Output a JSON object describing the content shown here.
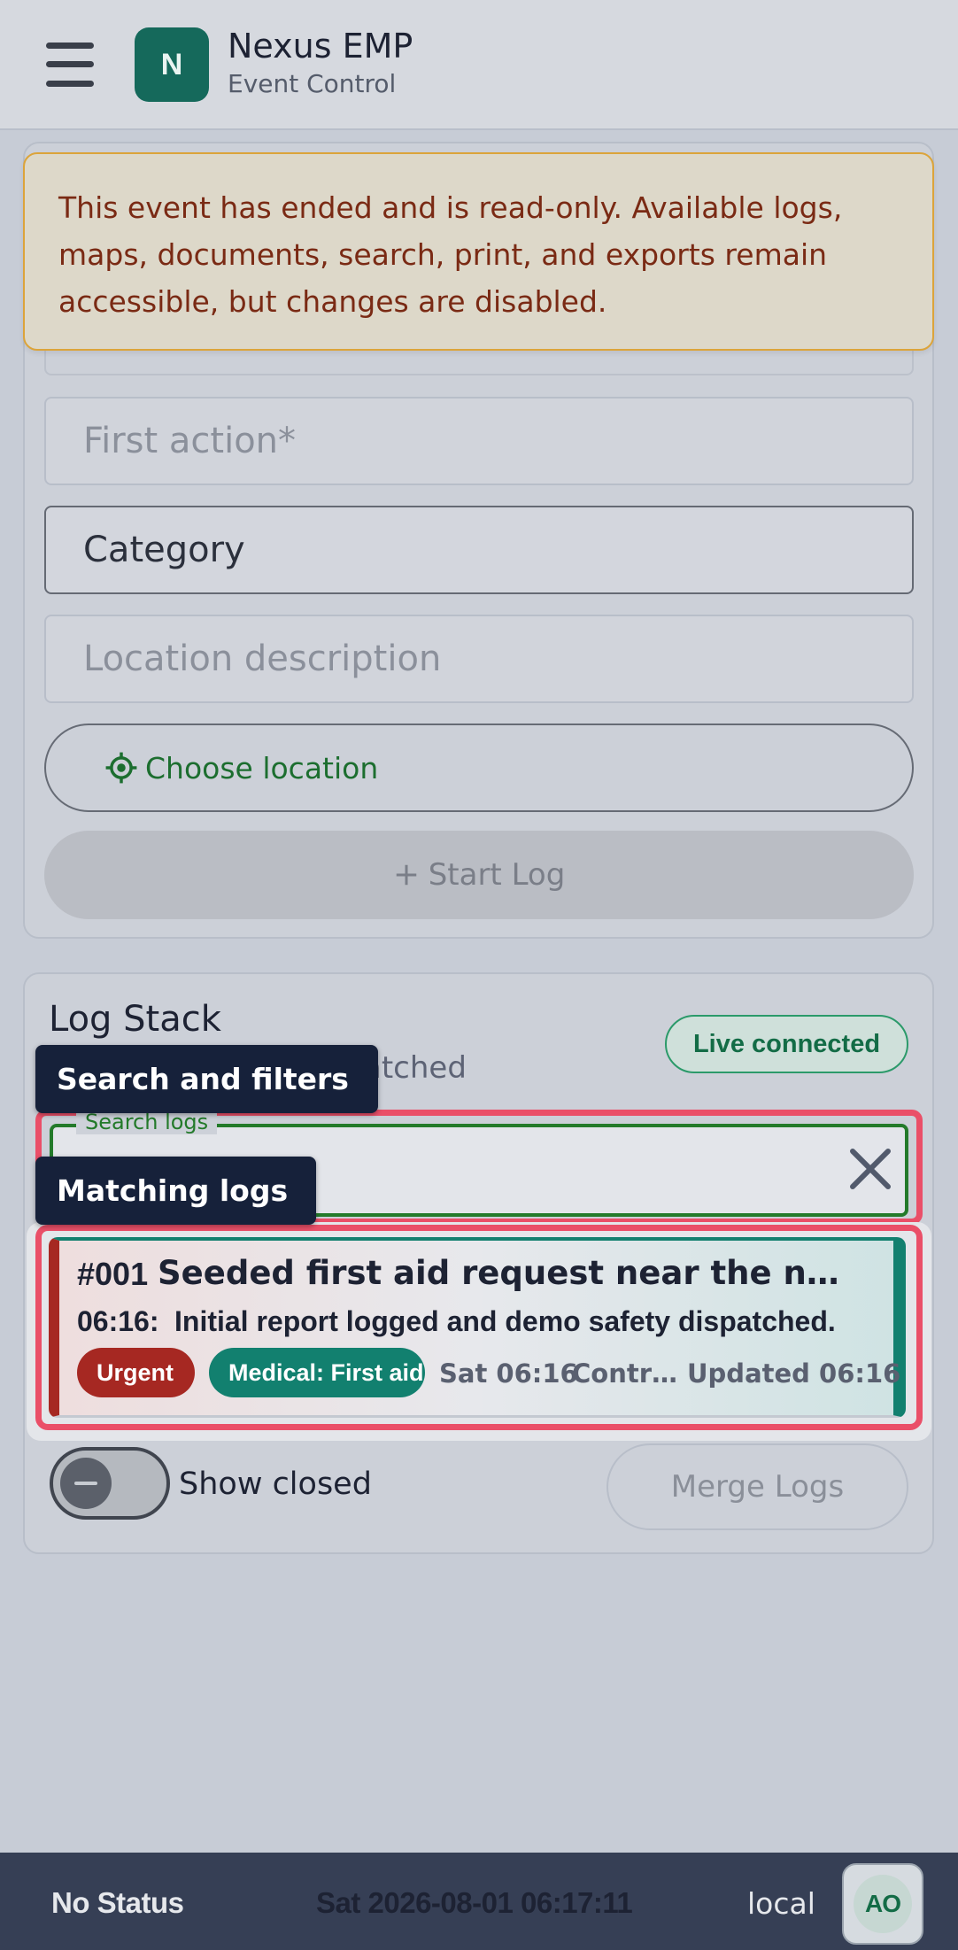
{
  "header": {
    "logo_letter": "N",
    "app_title": "Nexus EMP",
    "app_subtitle": "Event Control"
  },
  "banner": {
    "text": "This event has ended and is read-only. Available logs, maps, documents, search, print, and exports remain accessible, but changes are disabled."
  },
  "form": {
    "first_action_placeholder": "First action*",
    "category_label": "Category",
    "location_placeholder": "Location description",
    "choose_location_label": "Choose location",
    "start_log_label": "Start Log"
  },
  "log_stack": {
    "title": "Log Stack",
    "subtitle_visible": "atched",
    "live_status": "Live connected",
    "search_label": "Search logs",
    "tooltip_search": "Search and filters",
    "tooltip_matching": "Matching logs",
    "show_closed_label": "Show closed",
    "merge_label": "Merge Logs"
  },
  "logs": [
    {
      "number": "#001",
      "title": "Seeded first aid request near the north gate",
      "time": "06:16:",
      "description": "Initial report logged and demo safety dispatched.",
      "priority": "Urgent",
      "category": "Medical: First aid",
      "date": "Sat 06:16",
      "owner": "Contr…",
      "updated": "Updated 06:16"
    }
  ],
  "footer": {
    "status": "No Status",
    "clock": "Sat 2026-08-01 06:17:11",
    "mode": "local",
    "avatar_initials": "AO"
  },
  "colors": {
    "brand": "#15695b",
    "urgent": "#a62822",
    "medical": "#12806f",
    "highlight": "#ea4f68",
    "warning_border": "#dca43a"
  }
}
